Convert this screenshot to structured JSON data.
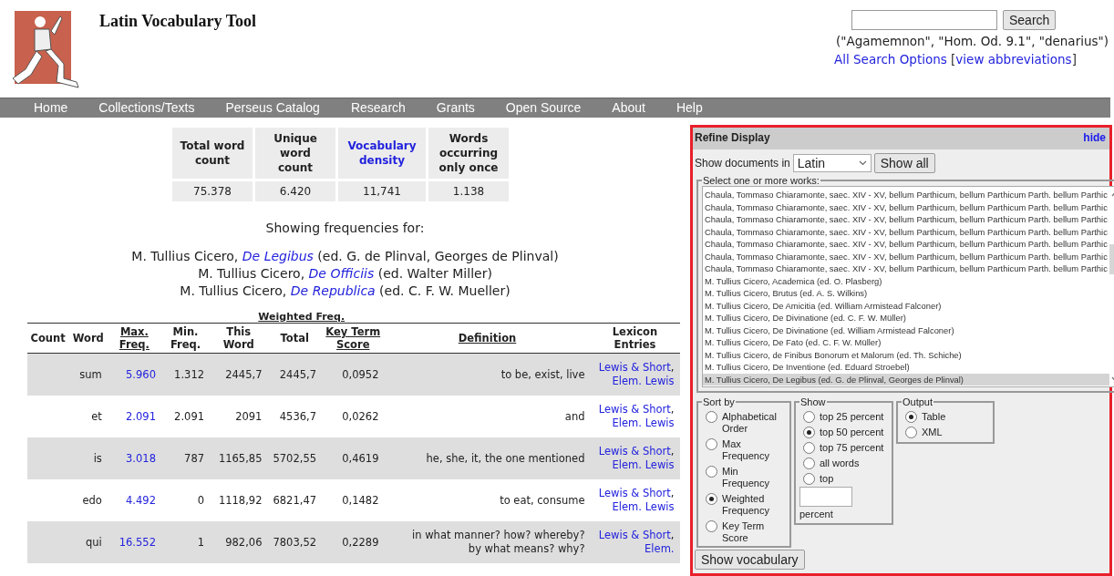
{
  "header": {
    "title": "Latin Vocabulary Tool",
    "search": {
      "button": "Search",
      "examples": "(\"Agamemnon\", \"Hom. Od. 9.1\", \"denarius\")",
      "options_line": [
        {
          "text": "All Search Options",
          "link": true
        },
        {
          "text": " [",
          "link": false
        },
        {
          "text": "view abbreviations",
          "link": true
        },
        {
          "text": "]",
          "link": false
        }
      ]
    }
  },
  "nav": [
    "Home",
    "Collections/Texts",
    "Perseus Catalog",
    "Research",
    "Grants",
    "Open Source",
    "About",
    "Help"
  ],
  "stats": {
    "columns": [
      {
        "label": "Total word count",
        "link": false
      },
      {
        "label": "Unique word count",
        "link": false
      },
      {
        "label": "Vocabulary density",
        "link": true
      },
      {
        "label": "Words occurring only once",
        "link": false
      }
    ],
    "values": [
      "75.378",
      "6.420",
      "11,741",
      "1.138"
    ]
  },
  "showing": "Showing frequencies for:",
  "works": [
    [
      {
        "text": "M. Tullius Cicero, ",
        "link": false
      },
      {
        "text": "De Legibus",
        "link": true
      },
      {
        "text": " (ed. G. de Plinval, Georges de Plinval)",
        "link": false
      }
    ],
    [
      {
        "text": "M. Tullius Cicero, ",
        "link": false
      },
      {
        "text": "De Officiis",
        "link": true
      },
      {
        "text": " (ed. Walter Miller)",
        "link": false
      }
    ],
    [
      {
        "text": "M. Tullius Cicero, ",
        "link": false
      },
      {
        "text": "De Republica",
        "link": true
      },
      {
        "text": " (ed. C. F. W. Mueller)",
        "link": false
      }
    ]
  ],
  "table": {
    "group_header": "Weighted Freq.",
    "columns": [
      {
        "label": "Count",
        "link": false
      },
      {
        "label": "Word",
        "link": false
      },
      {
        "label": "Max. Freq.",
        "link": true
      },
      {
        "label": "Min. Freq.",
        "link": false
      },
      {
        "label": "This Word",
        "link": false
      },
      {
        "label": "Total",
        "link": false
      },
      {
        "label": "Key Term Score",
        "link": true
      },
      {
        "label": "Definition",
        "link": true
      },
      {
        "label": "Lexicon Entries",
        "link": false
      }
    ],
    "rows": [
      {
        "word": "sum",
        "max": "5.960",
        "min": "1.312",
        "this": "2445,7",
        "total": "2445,7",
        "key": "0,0952",
        "definition": "to be, exist, live",
        "lexicon": [
          {
            "text": "Lewis & Short",
            "link": true
          },
          {
            "text": ", ",
            "link": false
          },
          {
            "text": "Elem. Lewis",
            "link": true
          }
        ]
      },
      {
        "word": "et",
        "max": "2.091",
        "min": "2.091",
        "this": "2091",
        "total": "4536,7",
        "key": "0,0262",
        "definition": "and",
        "lexicon": [
          {
            "text": "Lewis & Short",
            "link": true
          },
          {
            "text": ", ",
            "link": false
          },
          {
            "text": "Elem. Lewis",
            "link": true
          }
        ]
      },
      {
        "word": "is",
        "max": "3.018",
        "min": "787",
        "this": "1165,85",
        "total": "5702,55",
        "key": "0,4619",
        "definition": "he, she, it, the one mentioned",
        "lexicon": [
          {
            "text": "Lewis & Short",
            "link": true
          },
          {
            "text": ", ",
            "link": false
          },
          {
            "text": "Elem. Lewis",
            "link": true
          }
        ]
      },
      {
        "word": "edo",
        "max": "4.492",
        "min": "0",
        "this": "1118,92",
        "total": "6821,47",
        "key": "0,1482",
        "definition": "to eat, consume",
        "lexicon": [
          {
            "text": "Lewis & Short",
            "link": true
          },
          {
            "text": ", ",
            "link": false
          },
          {
            "text": "Elem. Lewis",
            "link": true
          }
        ]
      },
      {
        "word": "qui",
        "max": "16.552",
        "min": "1",
        "this": "982,06",
        "total": "7803,52",
        "key": "0,2289",
        "definition": "in what manner? how? whereby? by what means? why?",
        "lexicon": [
          {
            "text": "Lewis & Short",
            "link": true
          },
          {
            "text": ", ",
            "link": false
          },
          {
            "text": "Elem.",
            "link": true
          }
        ]
      }
    ]
  },
  "refine": {
    "title": "Refine Display",
    "hide": "hide",
    "docs_label": "Show documents in",
    "language": "Latin",
    "show_all": "Show all",
    "works_legend": "Select one or more works:",
    "work_list": [
      {
        "label": "Chaula, Tommaso Chiaramonte, saec. XIV - XV, bellum Parthicum, bellum Parthicum Parth. bellum Parthic",
        "selected": false
      },
      {
        "label": "Chaula, Tommaso Chiaramonte, saec. XIV - XV, bellum Parthicum, bellum Parthicum Parth. bellum Parthic",
        "selected": false
      },
      {
        "label": "Chaula, Tommaso Chiaramonte, saec. XIV - XV, bellum Parthicum, bellum Parthicum Parth. bellum Parthic",
        "selected": false
      },
      {
        "label": "Chaula, Tommaso Chiaramonte, saec. XIV - XV, bellum Parthicum, bellum Parthicum Parth. bellum Parthic",
        "selected": false
      },
      {
        "label": "Chaula, Tommaso Chiaramonte, saec. XIV - XV, bellum Parthicum, bellum Parthicum Parth. bellum Parthic",
        "selected": false
      },
      {
        "label": "Chaula, Tommaso Chiaramonte, saec. XIV - XV, bellum Parthicum, bellum Parthicum Parth. bellum Parthic",
        "selected": false
      },
      {
        "label": "Chaula, Tommaso Chiaramonte, saec. XIV - XV, bellum Parthicum, bellum Parthicum Parth. bellum Parthic",
        "selected": false
      },
      {
        "label": "M. Tullius Cicero, Academica (ed. O. Plasberg)",
        "selected": false
      },
      {
        "label": "M. Tullius Cicero, Brutus (ed. A. S. Wilkins)",
        "selected": false
      },
      {
        "label": "M. Tullius Cicero, De Amicitia (ed. William Armistead Falconer)",
        "selected": false
      },
      {
        "label": "M. Tullius Cicero, De Divinatione (ed. C. F. W. Müller)",
        "selected": false
      },
      {
        "label": "M. Tullius Cicero, De Divinatione (ed. William Armistead Falconer)",
        "selected": false
      },
      {
        "label": "M. Tullius Cicero, De Fato (ed. C. F. W. Müller)",
        "selected": false
      },
      {
        "label": "M. Tullius Cicero, de Finibus Bonorum et Malorum (ed. Th. Schiche)",
        "selected": false
      },
      {
        "label": "M. Tullius Cicero, De Inventione (ed. Eduard Stroebel)",
        "selected": false
      },
      {
        "label": "M. Tullius Cicero, De Legibus (ed. G. de Plinval, Georges de Plinval)",
        "selected": true
      }
    ],
    "sort": {
      "legend": "Sort by",
      "options": [
        {
          "label": "Alphabetical Order",
          "selected": false
        },
        {
          "label": "Max Frequency",
          "selected": false
        },
        {
          "label": "Min Frequency",
          "selected": false
        },
        {
          "label": "Weighted Frequency",
          "selected": true
        },
        {
          "label": "Key Term Score",
          "selected": false
        }
      ]
    },
    "show": {
      "legend": "Show",
      "options": [
        {
          "label": "top 25 percent",
          "selected": false
        },
        {
          "label": "top 50 percent",
          "selected": true
        },
        {
          "label": "top 75 percent",
          "selected": false
        },
        {
          "label": "all words",
          "selected": false
        },
        {
          "label": "top",
          "selected": false
        }
      ],
      "unit": "percent"
    },
    "output": {
      "legend": "Output",
      "options": [
        {
          "label": "Table",
          "selected": true
        },
        {
          "label": "XML",
          "selected": false
        }
      ]
    },
    "submit": "Show vocabulary"
  }
}
